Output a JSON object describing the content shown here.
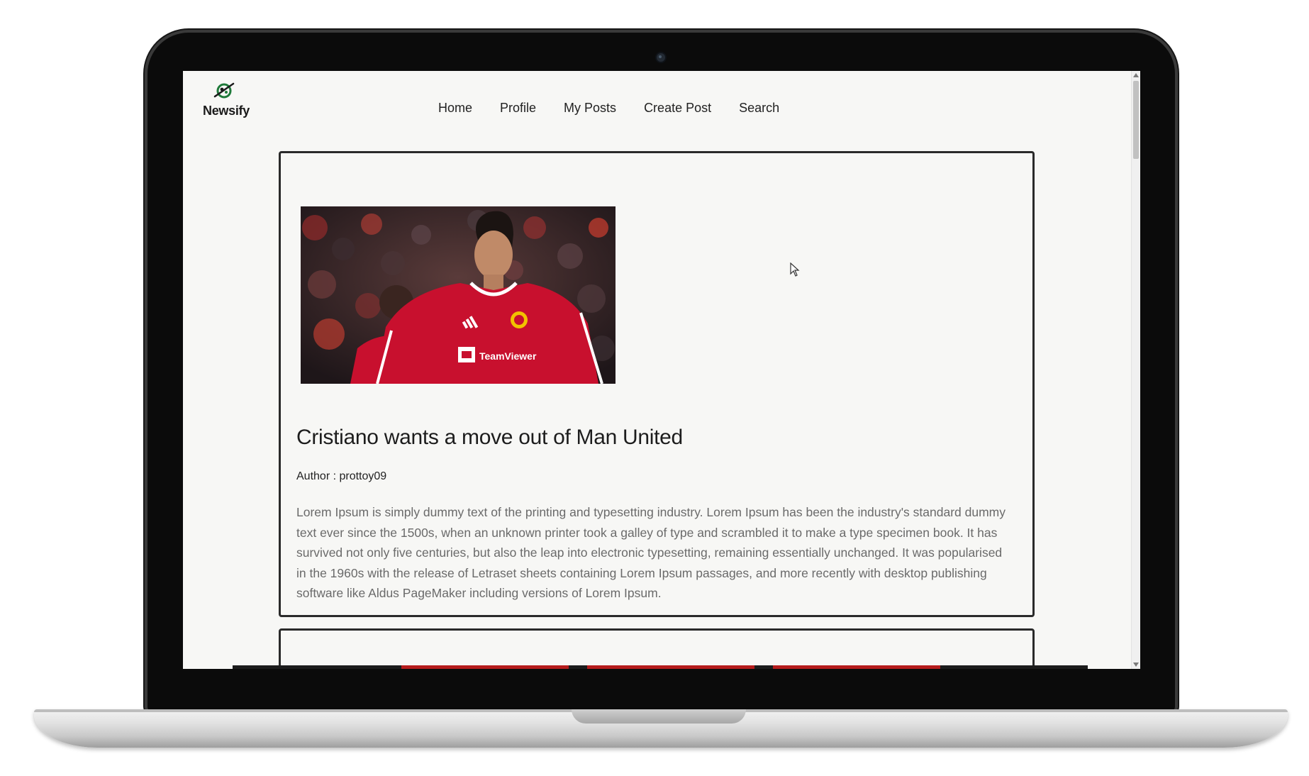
{
  "app": {
    "logo_text": "Newsify"
  },
  "nav": {
    "items": [
      {
        "label": "Home"
      },
      {
        "label": "Profile"
      },
      {
        "label": "My Posts"
      },
      {
        "label": "Create Post"
      },
      {
        "label": "Search"
      }
    ]
  },
  "post": {
    "image_icon": "football-player-photo",
    "title": "Cristiano wants a move out of Man United",
    "author": "Author : prottoy09",
    "body": "Lorem Ipsum is simply dummy text of the printing and typesetting industry. Lorem Ipsum has been the industry's standard dummy text ever since the 1500s, when an unknown printer took a galley of type and scrambled it to make a type specimen book. It has survived not only five centuries, but also the leap into electronic typesetting, remaining essentially unchanged. It was popularised in the 1960s with the release of Letraset sheets containing Lorem Ipsum passages, and more recently with desktop publishing software like Aldus PageMaker including versions of Lorem Ipsum."
  },
  "colors": {
    "page_background": "#f7f7f5",
    "card_border": "#2a2a2a",
    "logo_green": "#1f7a3a",
    "jersey_red": "#c8102e"
  }
}
